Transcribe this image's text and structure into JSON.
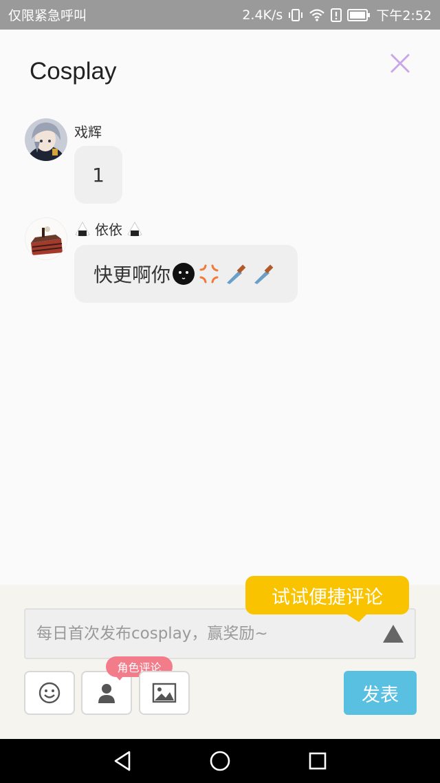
{
  "status_bar": {
    "carrier_text": "仅限紧急呼叫",
    "speed": "2.4K/s",
    "time": "下午2:52"
  },
  "header": {
    "title": "Cosplay"
  },
  "comments": [
    {
      "author": "戏辉",
      "text": "1"
    },
    {
      "author": "依依",
      "text": "快更啊你"
    }
  ],
  "composer": {
    "tip": "试试便捷评论",
    "placeholder": "每日首次发布cosplay，赢奖励~",
    "role_badge": "角色评论",
    "send_label": "发表"
  },
  "icons": {
    "close": "close-icon",
    "expand": "triangle-up-icon",
    "emoji": "smiley-icon",
    "role": "person-icon",
    "image": "image-icon",
    "nav_back": "back-triangle-icon",
    "nav_home": "home-circle-icon",
    "nav_recent": "recent-square-icon"
  },
  "colors": {
    "accent_send": "#5ac0e2",
    "tip": "#f9c300",
    "role_badge": "#f37c8a",
    "close_icon": "#c9a7e6"
  }
}
